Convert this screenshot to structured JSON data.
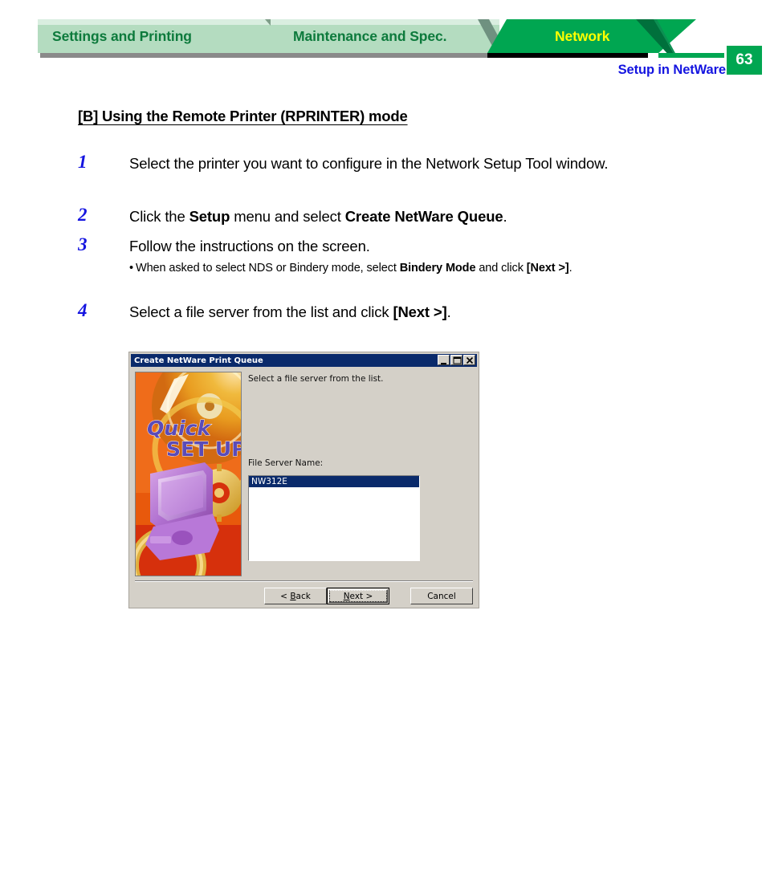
{
  "header": {
    "tabs": [
      {
        "label": "Settings and Printing",
        "active": false
      },
      {
        "label": "Maintenance and Spec.",
        "active": false
      },
      {
        "label": "Network",
        "active": true
      }
    ],
    "page_number": "63",
    "subtitle": "Setup in NetWare",
    "colors": {
      "tab_inactive_bg": "#b4dcc0",
      "tab_inactive_text": "#0d7a3c",
      "tab_active_bg": "#00a651",
      "tab_active_text": "#ffff00",
      "page_box_bg": "#00a651",
      "subtitle_color": "#1414e0"
    }
  },
  "content": {
    "heading": "[B] Using the Remote Printer (RPRINTER) mode",
    "steps": [
      {
        "number": "1",
        "text_before": "Select the printer you want to configure in the Network Setup Tool window.",
        "bold_1": "",
        "text_mid": "",
        "bold_2": "",
        "text_after": ""
      },
      {
        "number": "2",
        "text_before": "Click the ",
        "bold_1": "Setup",
        "text_mid": " menu and select ",
        "bold_2": "Create NetWare Queue",
        "text_after": "."
      },
      {
        "number": "3",
        "text_before": "Follow the instructions on the screen.",
        "bold_1": "",
        "text_mid": "",
        "bold_2": "",
        "text_after": ""
      },
      {
        "number": "4",
        "text_before": "Select a file server from the list and click ",
        "bold_1": "[Next >]",
        "text_mid": ".",
        "bold_2": "",
        "text_after": ""
      }
    ],
    "sub_note": {
      "bullet": "•",
      "text_before": "When asked to select NDS or Bindery mode, select ",
      "bold_1": "Bindery Mode",
      "text_mid": " and click ",
      "bold_2": "[Next >]",
      "text_after": "."
    },
    "step_number_color": "#1414e0"
  },
  "dialog": {
    "title": "Create NetWare Print Queue",
    "titlebar_color": "#0a2a6b",
    "window_controls": [
      {
        "name": "minimize-button",
        "glyph": "_"
      },
      {
        "name": "maximize-button",
        "glyph": "□"
      },
      {
        "name": "close-button",
        "glyph": "✕"
      }
    ],
    "instruction": "Select a file server from the list.",
    "file_server_label": "File Server Name:",
    "file_server_list": [
      {
        "value": "NW312E",
        "selected": true
      }
    ],
    "graphic": {
      "line1": "Quick",
      "line2": "SET UP",
      "text_color": "#5a4bb8",
      "bg_color": "#e8590c"
    },
    "buttons": [
      {
        "name": "back-button",
        "prefix": "< ",
        "accel": "B",
        "suffix": "ack",
        "default": false
      },
      {
        "name": "next-button",
        "prefix": "",
        "accel": "N",
        "suffix": "ext >",
        "default": true
      },
      {
        "name": "cancel-button",
        "prefix": "",
        "accel": "",
        "suffix": "Cancel",
        "default": false
      }
    ]
  }
}
